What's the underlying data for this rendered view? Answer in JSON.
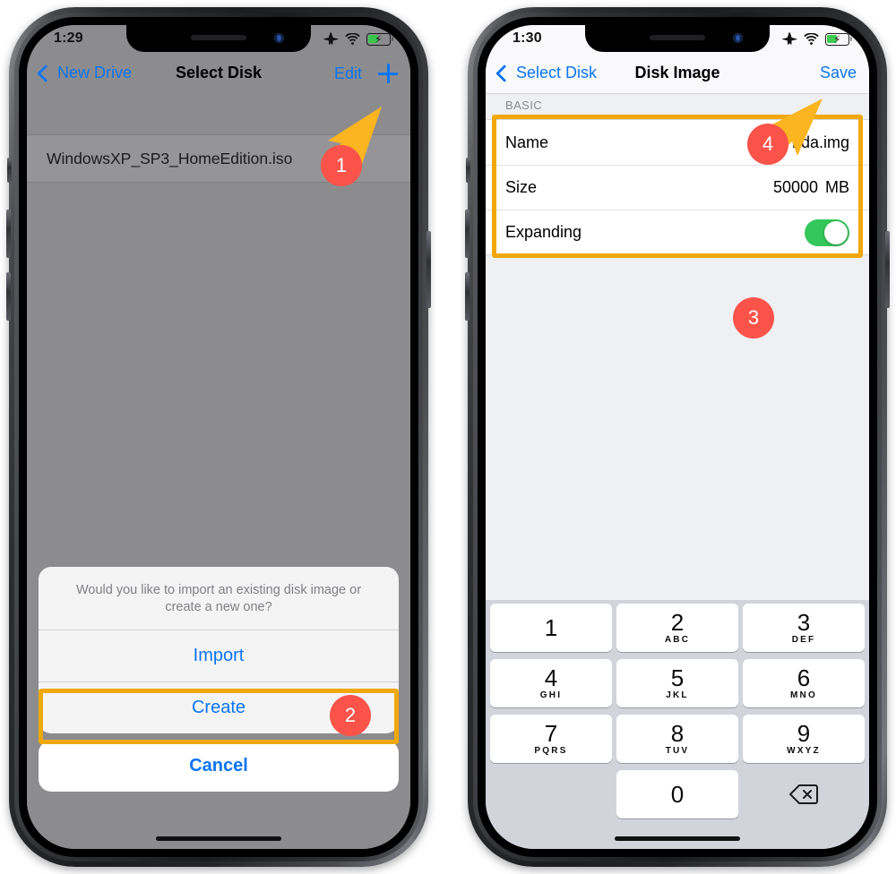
{
  "left_phone": {
    "status_bar": {
      "time": "1:29",
      "icons": [
        "airplane-icon",
        "wifi-icon",
        "battery-charging-icon"
      ]
    },
    "nav": {
      "back_label": "New Drive",
      "title": "Select Disk",
      "edit_label": "Edit",
      "add_icon": "plus-icon"
    },
    "list": {
      "rows": [
        {
          "label": "WindowsXP_SP3_HomeEdition.iso"
        }
      ]
    },
    "action_sheet": {
      "message": "Would you like to import an existing disk image or create a new one?",
      "buttons": [
        "Import",
        "Create"
      ],
      "cancel_label": "Cancel"
    },
    "annotations": [
      {
        "number": "1"
      },
      {
        "number": "2"
      }
    ]
  },
  "right_phone": {
    "status_bar": {
      "time": "1:30",
      "icons": [
        "airplane-icon",
        "wifi-icon",
        "battery-charging-icon"
      ]
    },
    "nav": {
      "back_label": "Select Disk",
      "title": "Disk Image",
      "save_label": "Save"
    },
    "section_header": "BASIC",
    "form_rows": [
      {
        "label": "Name",
        "value": "hda.img",
        "unit": "",
        "type": "text"
      },
      {
        "label": "Size",
        "value": "50000",
        "unit": "MB",
        "type": "number"
      },
      {
        "label": "Expanding",
        "value": "on",
        "unit": "",
        "type": "toggle"
      }
    ],
    "keypad": {
      "keys": [
        {
          "num": "1",
          "letters": ""
        },
        {
          "num": "2",
          "letters": "ABC"
        },
        {
          "num": "3",
          "letters": "DEF"
        },
        {
          "num": "4",
          "letters": "GHI"
        },
        {
          "num": "5",
          "letters": "JKL"
        },
        {
          "num": "6",
          "letters": "MNO"
        },
        {
          "num": "7",
          "letters": "PQRS"
        },
        {
          "num": "8",
          "letters": "TUV"
        },
        {
          "num": "9",
          "letters": "WXYZ"
        },
        {
          "num": "0",
          "letters": ""
        }
      ],
      "delete_icon": "backspace-icon"
    },
    "annotations": [
      {
        "number": "3"
      },
      {
        "number": "4"
      }
    ]
  },
  "colors": {
    "ios_blue": "#0a74f0",
    "badge_red": "#f9534a",
    "highlight_amber": "#f0a80d",
    "arrow_yellow": "#fab520",
    "toggle_green": "#34c759",
    "battery_green": "#36c94a"
  }
}
